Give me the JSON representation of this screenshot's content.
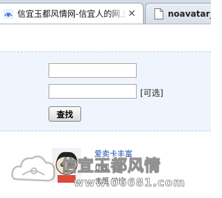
{
  "tabs": [
    {
      "title": "信宜玉都风情网-信宜人的网上家园",
      "active": true,
      "close_symbol": "✕"
    },
    {
      "title": "noavatar_small",
      "active": false
    }
  ],
  "form": {
    "field1_value": "",
    "field2_value": "",
    "optional_label": "[可选]",
    "search_label": "查找"
  },
  "footer": {
    "link_text": "爱卖卡丰富",
    "meta_line1": "UID: 11",
    "meta_line2": "主题 讨论"
  },
  "watermark": {
    "title": "信宜玉都风情",
    "url": "www.06681.com"
  },
  "colors": {
    "panel_bg": "#eef5fc",
    "panel_border": "#b9cde4",
    "tabstrip_bg": "#c4cedb"
  }
}
